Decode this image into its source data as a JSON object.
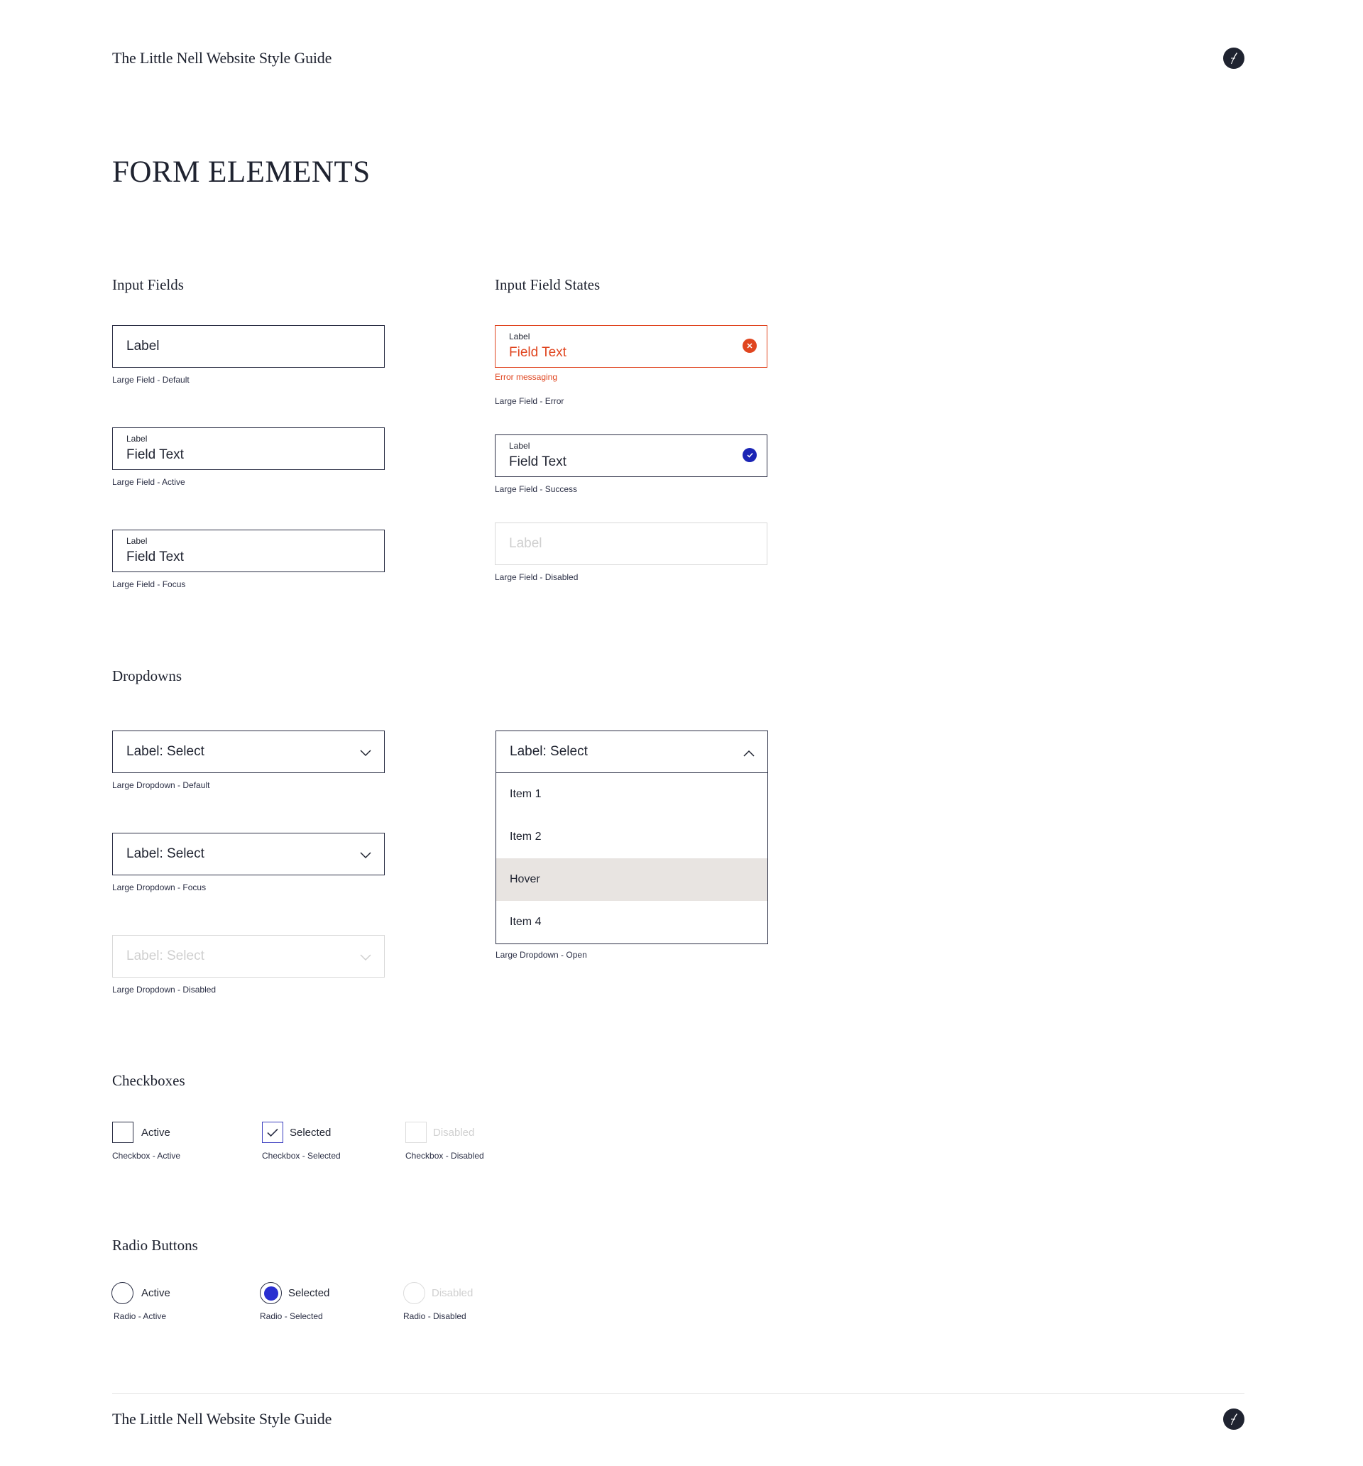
{
  "header": {
    "site_title": "The Little Nell Website Style Guide",
    "logo_icon": "quill-logo-icon"
  },
  "page_title": "FORM ELEMENTS",
  "input_fields": {
    "title": "Input Fields",
    "default": {
      "label": "Label",
      "caption": "Large Field - Default"
    },
    "active": {
      "label": "Label",
      "value": "Field Text",
      "caption": "Large Field - Active"
    },
    "focus": {
      "label": "Label",
      "value": "Field Text",
      "caption": "Large Field - Focus"
    }
  },
  "input_states": {
    "title": "Input Field States",
    "error": {
      "label": "Label",
      "value": "Field Text",
      "message": "Error messaging",
      "caption": "Large Field - Error",
      "icon": "error-x-icon",
      "color": "#e0451f"
    },
    "success": {
      "label": "Label",
      "value": "Field Text",
      "caption": "Large Field - Success",
      "icon": "success-check-icon",
      "color": "#1a24b5"
    },
    "disabled": {
      "label": "Label",
      "caption": "Large Field - Disabled"
    }
  },
  "dropdowns": {
    "title": "Dropdowns",
    "default": {
      "label": "Label: Select",
      "caption": "Large Dropdown - Default"
    },
    "focus": {
      "label": "Label: Select",
      "caption": "Large Dropdown - Focus"
    },
    "disabled": {
      "label": "Label: Select",
      "caption": "Large Dropdown - Disabled"
    },
    "open": {
      "label": "Label: Select",
      "items": [
        "Item 1",
        "Item 2",
        "Hover",
        "Item 4"
      ],
      "caption": "Large Dropdown - Open"
    }
  },
  "checkboxes": {
    "title": "Checkboxes",
    "active": {
      "label": "Active",
      "caption": "Checkbox - Active"
    },
    "selected": {
      "label": "Selected",
      "caption": "Checkbox - Selected"
    },
    "disabled": {
      "label": "Disabled",
      "caption": "Checkbox - Disabled"
    }
  },
  "radios": {
    "title": "Radio Buttons",
    "active": {
      "label": "Active",
      "caption": "Radio - Active"
    },
    "selected": {
      "label": "Selected",
      "caption": "Radio - Selected"
    },
    "disabled": {
      "label": "Disabled",
      "caption": "Radio - Disabled"
    }
  },
  "footer": {
    "site_title": "The Little Nell Website Style Guide"
  },
  "colors": {
    "ink": "#1f2330",
    "error": "#e0451f",
    "accent": "#2a2fd0",
    "hover": "#e8e4e1",
    "disabled": "#d9d9d9"
  }
}
